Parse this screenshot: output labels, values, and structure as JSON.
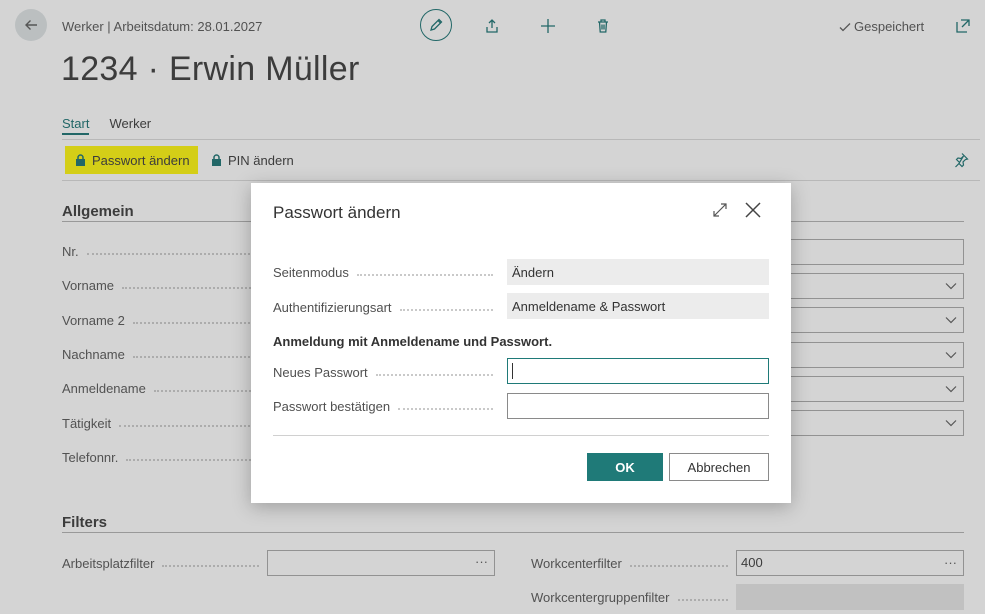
{
  "header": {
    "subtitle": "Werker | Arbeitsdatum: 28.01.2027",
    "title": "1234 · Erwin Müller",
    "saved_label": "Gespeichert"
  },
  "tabs": [
    {
      "label": "Start"
    },
    {
      "label": "Werker"
    }
  ],
  "actions": {
    "password_change": "Passwort ändern",
    "pin_change": "PIN ändern"
  },
  "general": {
    "heading": "Allgemein",
    "fields": [
      {
        "label": "Nr."
      },
      {
        "label": "Vorname"
      },
      {
        "label": "Vorname 2"
      },
      {
        "label": "Nachname"
      },
      {
        "label": "Anmeldename"
      },
      {
        "label": "Tätigkeit"
      },
      {
        "label": "Telefonnr."
      }
    ]
  },
  "filters": {
    "heading": "Filters",
    "workplace_filter_label": "Arbeitsplatzfilter",
    "workplace_filter_value": "",
    "workcenter_filter_label": "Workcenterfilter",
    "workcenter_filter_value": "400",
    "workcenter_group_filter_label": "Workcentergruppenfilter",
    "ellipsis": "···"
  },
  "dialog": {
    "title": "Passwort ändern",
    "page_mode_label": "Seitenmodus",
    "page_mode_value": "Ändern",
    "auth_type_label": "Authentifizierungsart",
    "auth_type_value": "Anmeldename & Passwort",
    "info_text": "Anmeldung mit Anmeldename und Passwort.",
    "new_password_label": "Neues Passwort",
    "new_password_value": "",
    "confirm_password_label": "Passwort bestätigen",
    "confirm_password_value": "",
    "ok_label": "OK",
    "cancel_label": "Abbrechen"
  },
  "colors": {
    "accent": "#0f6d6d",
    "highlight": "#fff700",
    "ok_button": "#1f7a78"
  },
  "icons": [
    "back-arrow-icon",
    "pencil-icon",
    "share-icon",
    "plus-icon",
    "trash-icon",
    "check-icon",
    "open-new-window-icon",
    "lock-icon",
    "pin-icon",
    "chevron-down-icon",
    "expand-icon",
    "close-icon"
  ]
}
